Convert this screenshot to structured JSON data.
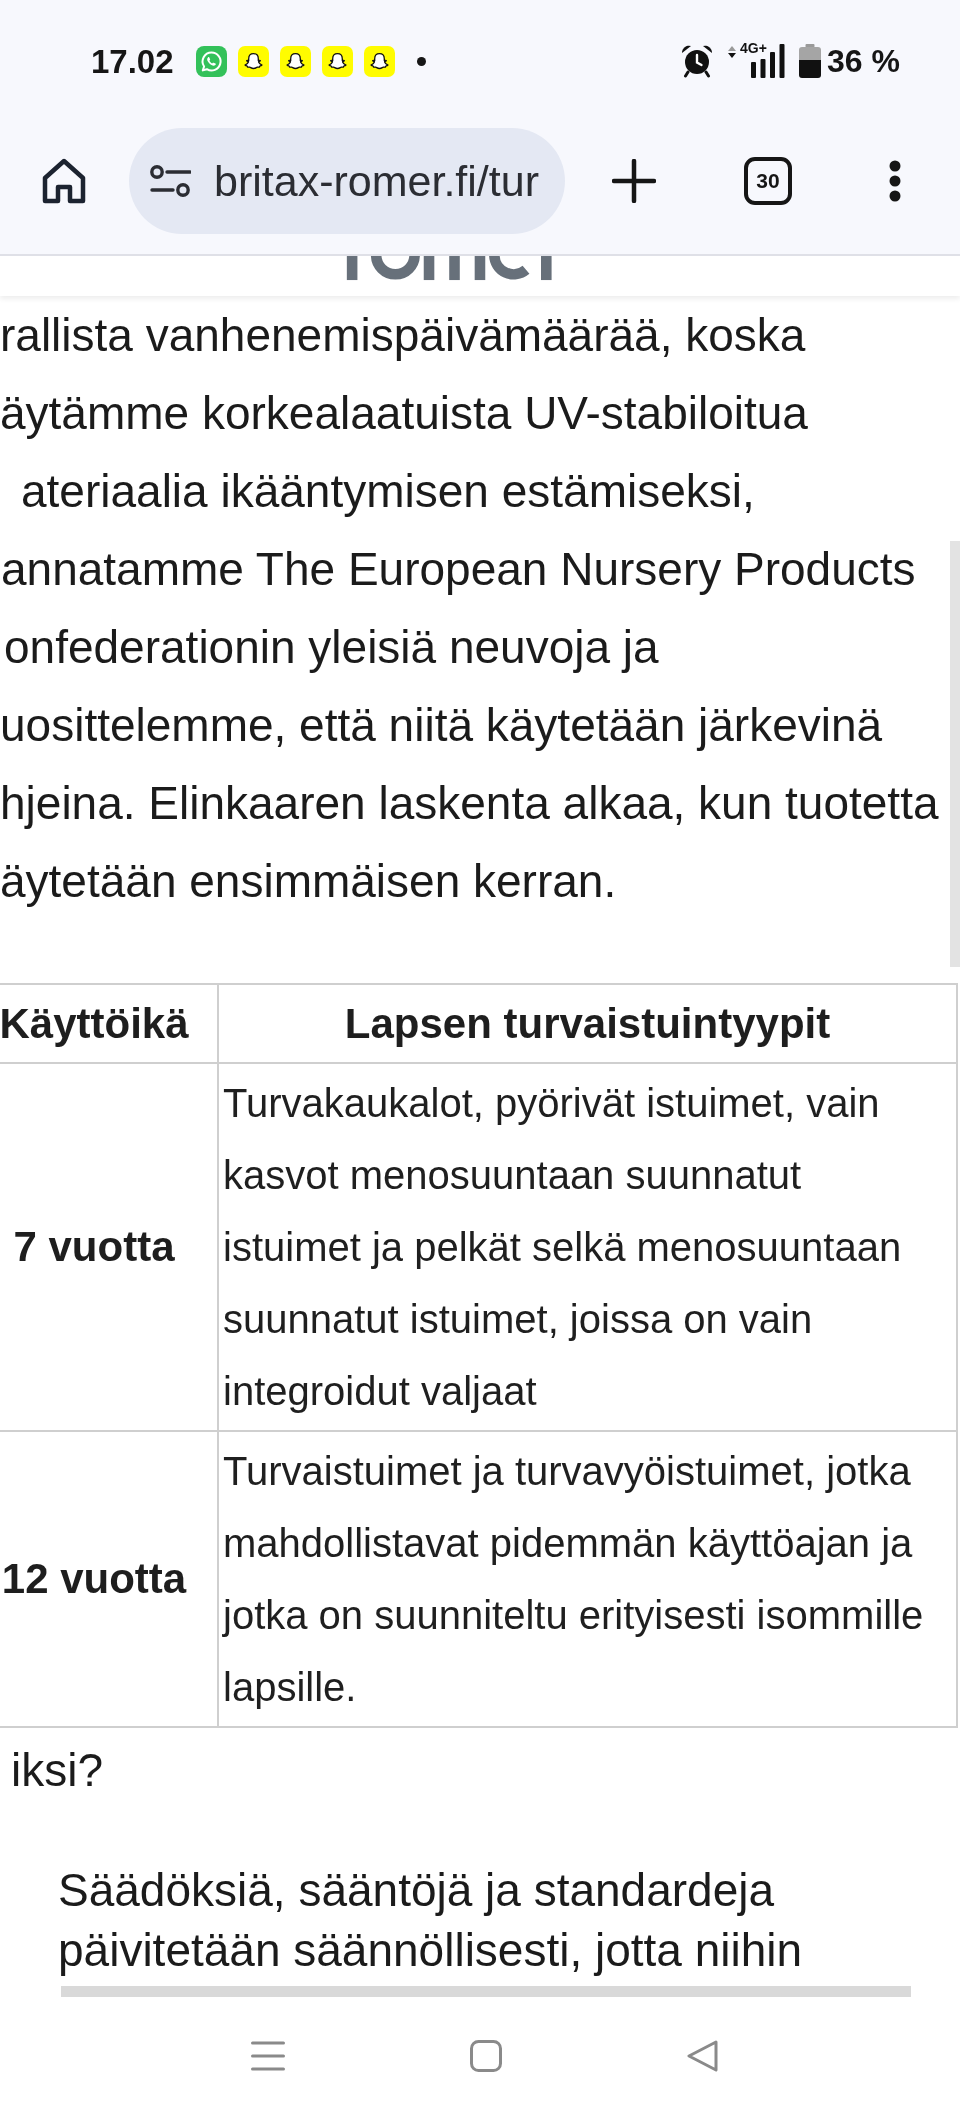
{
  "status_bar": {
    "time": "17.02",
    "notifications": [
      {
        "kind": "chat"
      },
      {
        "kind": "ghost"
      },
      {
        "kind": "ghost"
      },
      {
        "kind": "ghost"
      },
      {
        "kind": "ghost"
      },
      {
        "kind": "dot"
      }
    ],
    "network": "4G+",
    "battery": "36 %"
  },
  "browser": {
    "url": "britax-romer.fi/tur",
    "tab_count": "30"
  },
  "article": {
    "lines": [
      "rallista vanhenemispäivämäärää, koska",
      "äytämme korkealaatuista UV-stabiloitua",
      "ateriaalia ikääntymisen estämiseksi,",
      "annatamme The European Nursery Products",
      "onfederationin yleisiä neuvoja ja",
      "uosittelemme, että niitä käytetään järkevinä",
      "hjeina. Elinkaaren laskenta alkaa, kun tuotetta",
      "äytetään ensimmäisen kerran."
    ]
  },
  "table": {
    "columns": [
      "Käyttöikä",
      "Lapsen turvaistuintyypit"
    ],
    "rows": [
      {
        "cells": [
          "7 vuotta",
          "Turvakaukalot, pyörivät istuimet, vain kasvot menosuuntaan suunnatut istuimet ja pelkät selkä menosuuntaan suunnatut istuimet, joissa on vain integroidut valjaat"
        ]
      },
      {
        "cells": [
          "12 vuotta",
          "Turvaistuimet ja turvavyöistuimet, jotka mahdollistavat pidemmän käyttöajan ja jotka on suunniteltu erityisesti isommille lapsille."
        ]
      }
    ]
  },
  "section_label": "iksi?",
  "paragraph": "Säädöksiä, sääntöjä ja standardeja päivitetään säännöllisesti, jotta niihin"
}
